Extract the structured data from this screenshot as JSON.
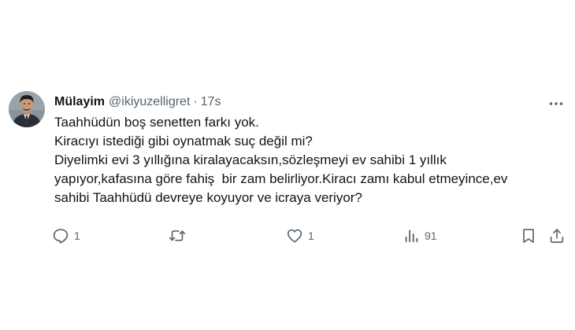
{
  "tweet": {
    "author_name": "Mülayim",
    "author_handle": "@ikiyuzelligret",
    "separator": "·",
    "time": "17s",
    "text_lines": [
      "Taahhüdün boş senetten farkı yok.",
      "Kiracıyı istediği gibi oynatmak suç değil mi?",
      "Diyelimki evi 3 yıllığına kiralayacaksın,sözleşmeyi ev sahibi 1 yıllık",
      "yapıyor,kafasına göre fahiş  bir zam belirliyor.Kiracı zamı kabul etmeyince,ev",
      "sahibi Taahhüdü devreye koyuyor ve icraya veriyor?"
    ],
    "actions": {
      "reply_count": "1",
      "retweet_count": "",
      "like_count": "1",
      "views_count": "91"
    },
    "icons": {
      "avatar": "avatar-photo",
      "more": "more-icon",
      "reply": "reply-icon",
      "retweet": "retweet-icon",
      "like": "heart-icon",
      "views": "views-icon",
      "bookmark": "bookmark-icon",
      "share": "share-icon"
    },
    "colors": {
      "text": "#0f1419",
      "secondary": "#536471",
      "background": "#ffffff"
    }
  }
}
